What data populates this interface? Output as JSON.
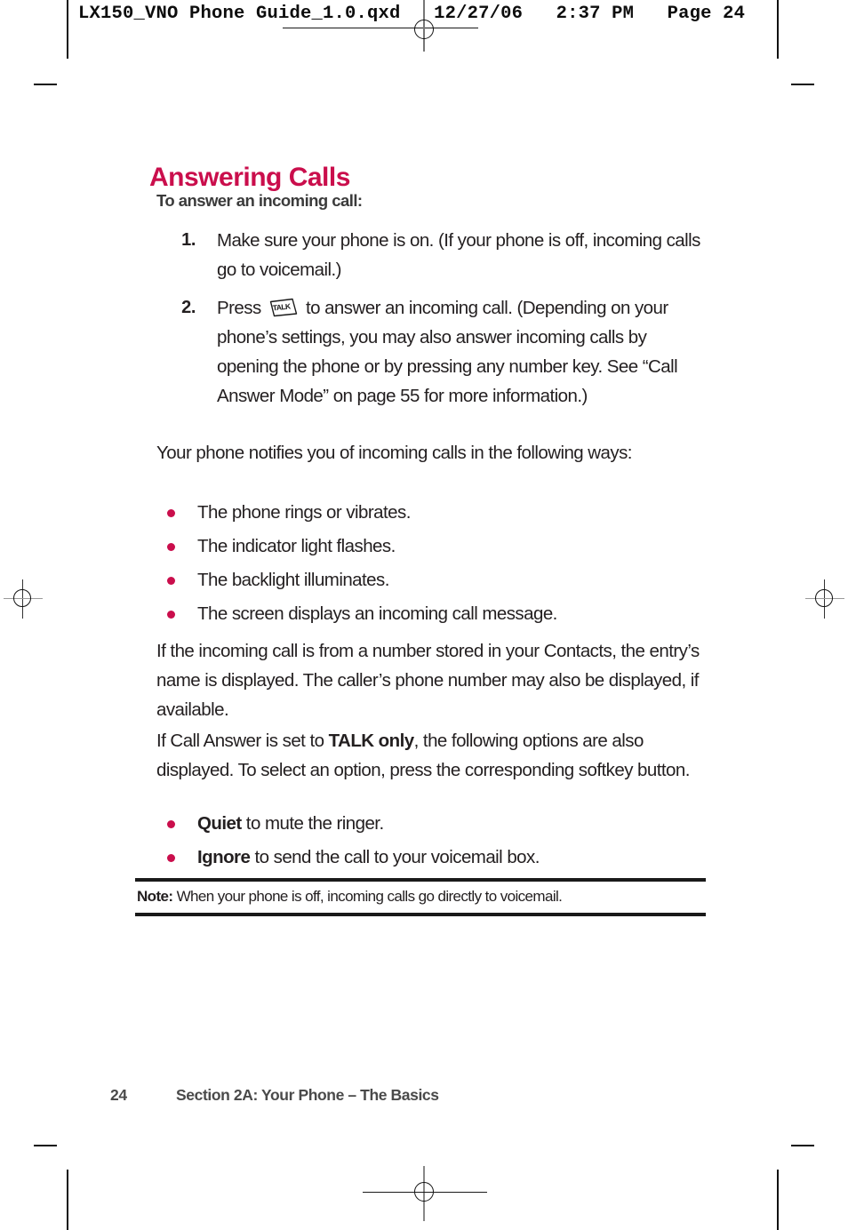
{
  "print_slug": "LX150_VNO Phone Guide_1.0.qxd   12/27/06   2:37 PM   Page 24",
  "colors": {
    "accent": "#ca0e4c",
    "body_text": "#231f20",
    "subhead": "#3b3b3b",
    "footer": "#4a4a4a"
  },
  "page": {
    "heading": "Answering Calls",
    "subheading": "To answer an incoming call:",
    "steps": [
      {
        "number": "1.",
        "text": "Make sure your phone is on. (If your phone is off, incoming calls go to voicemail.)"
      },
      {
        "number": "2.",
        "text_before_icon": "Press ",
        "icon": "talk-key-icon",
        "icon_label": "TALK",
        "text_after_icon": " to answer an incoming call. (Depending on your phone’s settings, you may also answer incoming calls by opening the phone or by pressing any number key. See “Call Answer Mode” on page 55 for more information.)"
      }
    ],
    "paragraph_notify": "Your phone notifies you of incoming calls in the following ways:",
    "notify_list": [
      "The phone rings or vibrates.",
      "The indicator light flashes.",
      "The backlight illuminates.",
      "The screen displays an incoming call message."
    ],
    "paragraph_contacts": "If the incoming call is from a number stored in your Contacts, the entry’s name is displayed. The caller’s phone number may also be displayed, if available.",
    "paragraph_callanswer": {
      "before_bold": "If Call Answer is set to ",
      "bold": "TALK only",
      "after_bold": ", the following options are also displayed. To select an option, press the corresponding softkey button."
    },
    "options_list": [
      {
        "bold": "Quiet",
        "rest": " to mute the ringer."
      },
      {
        "bold": "Ignore",
        "rest": " to send the call to your voicemail box."
      }
    ],
    "note": {
      "label": "Note:",
      "text": " When your phone is off, incoming calls go directly to voicemail."
    },
    "footer": {
      "page_number": "24",
      "section": "Section 2A: Your Phone – The Basics"
    }
  }
}
